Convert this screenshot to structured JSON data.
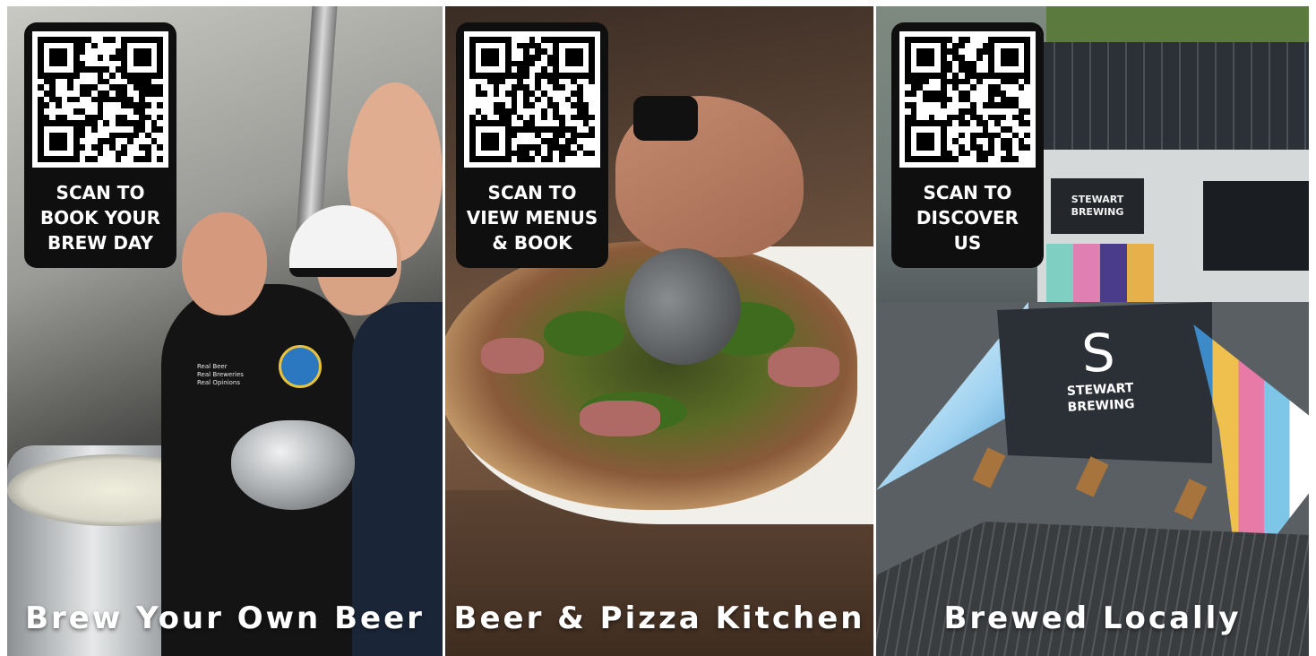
{
  "panels": [
    {
      "qr_label": "SCAN TO\nBOOK YOUR\nBREW DAY",
      "caption": "Brew Your Own Beer",
      "tshirt_text": "Real Beer\nReal Breweries\nReal Opinions"
    },
    {
      "qr_label": "SCAN TO\nVIEW MENUS\n& BOOK",
      "caption": "Beer & Pizza Kitchen"
    },
    {
      "qr_label": "SCAN TO\nDISCOVER\nUS",
      "caption": "Brewed Locally",
      "building_sign": "STEWART\nBREWING",
      "tent_sign": "STEWART\nBREWING"
    }
  ],
  "colors": {
    "card_bg": "#0f0f0f",
    "text": "#ffffff"
  },
  "icons": [
    "qr-code-icon",
    "stewart-brewing-logo-icon"
  ]
}
